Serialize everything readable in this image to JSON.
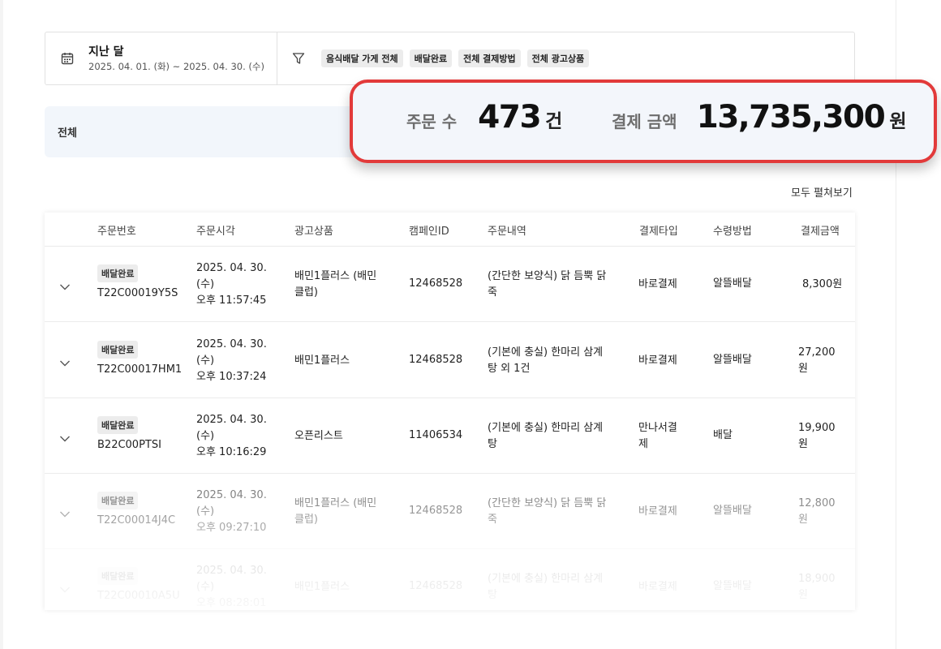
{
  "filter": {
    "period_title": "지난 달",
    "period_range": "2025. 04. 01. (화) ~ 2025. 04. 30. (수)",
    "chips": [
      "음식배달 가게 전체",
      "배달완료",
      "전체 결제방법",
      "전체 광고상품"
    ]
  },
  "summary": {
    "label": "전체",
    "order_count_label": "주문 수",
    "order_count_value": "473",
    "order_count_unit": "건",
    "payment_label": "결제 금액",
    "payment_value": "13,735,300",
    "payment_unit": "원",
    "highlight_color": "#e23a3a"
  },
  "expand_all": "모두 펼쳐보기",
  "table": {
    "headers": [
      "주문번호",
      "주문시각",
      "광고상품",
      "캠페인ID",
      "주문내역",
      "결제타입",
      "수령방법",
      "결제금액"
    ],
    "rows": [
      {
        "status": "배달완료",
        "order_no": "T22C00019Y5S",
        "time_lines": [
          "2025. 04. 30.",
          "(수)",
          "오후 11:57:45"
        ],
        "ad_lines": [
          "배민1플러스 (배민",
          "클럽)"
        ],
        "campaign": "12468528",
        "menu_lines": [
          "(간단한 보양식) 닭 듬뿍 닭",
          "죽"
        ],
        "pay_type_lines": [
          "바로결제"
        ],
        "receive": "알뜰배달",
        "amount_lines": [
          "8,300원"
        ]
      },
      {
        "status": "배달완료",
        "order_no": "T22C00017HM1",
        "time_lines": [
          "2025. 04. 30.",
          "(수)",
          "오후 10:37:24"
        ],
        "ad_lines": [
          "배민1플러스"
        ],
        "campaign": "12468528",
        "menu_lines": [
          "(기본에 충실) 한마리 삼계",
          "탕 외 1건"
        ],
        "pay_type_lines": [
          "바로결제"
        ],
        "receive": "알뜰배달",
        "amount_lines": [
          "27,200",
          "원"
        ]
      },
      {
        "status": "배달완료",
        "order_no": "B22C00PTSI",
        "time_lines": [
          "2025. 04. 30.",
          "(수)",
          "오후 10:16:29"
        ],
        "ad_lines": [
          "오픈리스트"
        ],
        "campaign": "11406534",
        "menu_lines": [
          "(기본에 충실) 한마리 삼계",
          "탕"
        ],
        "pay_type_lines": [
          "만나서결",
          "제"
        ],
        "receive": "배달",
        "amount_lines": [
          "19,900",
          "원"
        ]
      },
      {
        "status": "배달완료",
        "order_no": "T22C00014J4C",
        "time_lines": [
          "2025. 04. 30.",
          "(수)",
          "오후 09:27:10"
        ],
        "ad_lines": [
          "배민1플러스 (배민",
          "클럽)"
        ],
        "campaign": "12468528",
        "menu_lines": [
          "(간단한 보양식) 닭 듬뿍 닭",
          "죽"
        ],
        "pay_type_lines": [
          "바로결제"
        ],
        "receive": "알뜰배달",
        "amount_lines": [
          "12,800",
          "원"
        ]
      },
      {
        "status": "배달완료",
        "order_no": "T22C00010A5U",
        "time_lines": [
          "2025. 04. 30.",
          "(수)",
          "오후 08:28:01"
        ],
        "ad_lines": [
          "배민1플러스"
        ],
        "campaign": "12468528",
        "menu_lines": [
          "(기본에 충실) 한마리 삼계",
          "탕"
        ],
        "pay_type_lines": [
          "바로결제"
        ],
        "receive": "알뜰배달",
        "amount_lines": [
          "18,900",
          "원"
        ]
      }
    ]
  }
}
